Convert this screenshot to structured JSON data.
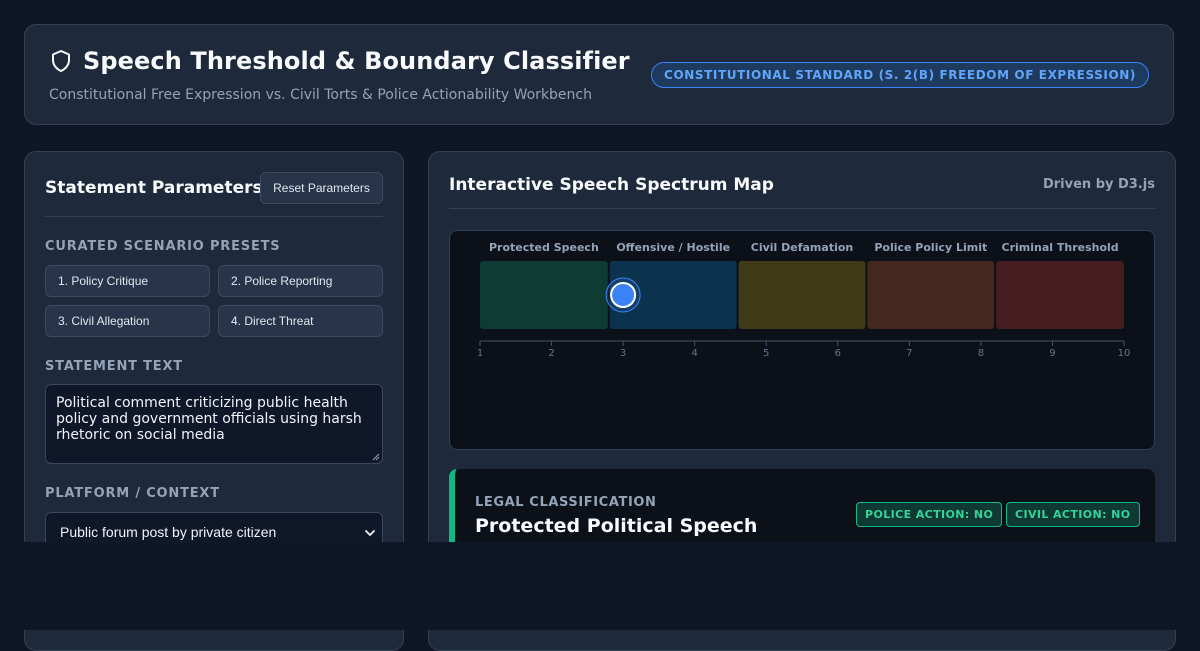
{
  "header": {
    "title": "Speech Threshold & Boundary Classifier",
    "subtitle": "Constitutional Free Expression vs. Civil Torts & Police Actionability Workbench",
    "standard_badge": "CONSTITUTIONAL STANDARD (S. 2(B) FREEDOM OF EXPRESSION)",
    "icon": "shield-icon"
  },
  "params": {
    "title": "Statement Parameters",
    "reset_label": "Reset Parameters",
    "presets_label": "CURATED SCENARIO PRESETS",
    "presets": [
      {
        "label": "1. Policy Critique"
      },
      {
        "label": "2. Police Reporting"
      },
      {
        "label": "3. Civil Allegation"
      },
      {
        "label": "4. Direct Threat"
      }
    ],
    "statement_label": "STATEMENT TEXT",
    "statement_text": "Political comment criticizing public health policy and government officials using harsh rhetoric on social media",
    "platform_label": "PLATFORM / CONTEXT",
    "platform_value": "Public forum post by private citizen"
  },
  "map": {
    "title": "Interactive Speech Spectrum Map",
    "driven_by": "Driven by D3.js",
    "zones": [
      {
        "label": "Protected Speech",
        "from": 1,
        "to": 2.8,
        "color": "#0f3b35"
      },
      {
        "label": "Offensive / Hostile",
        "from": 2.8,
        "to": 4.6,
        "color": "#0c334d"
      },
      {
        "label": "Civil Defamation",
        "from": 4.6,
        "to": 6.4,
        "color": "#3f3a17"
      },
      {
        "label": "Police Policy Limit",
        "from": 6.4,
        "to": 8.2,
        "color": "#44271d"
      },
      {
        "label": "Criminal Threshold",
        "from": 8.2,
        "to": 10,
        "color": "#461e22"
      }
    ],
    "ticks": [
      "1",
      "2",
      "3",
      "4",
      "5",
      "6",
      "7",
      "8",
      "9",
      "10"
    ],
    "score": 3,
    "marker_color": "#3b82f6"
  },
  "result": {
    "label": "LEGAL CLASSIFICATION",
    "title": "Protected Political Speech",
    "police_badge": "POLICE ACTION: NO",
    "civil_badge": "CIVIL ACTION: NO",
    "accent": "#10b981"
  }
}
